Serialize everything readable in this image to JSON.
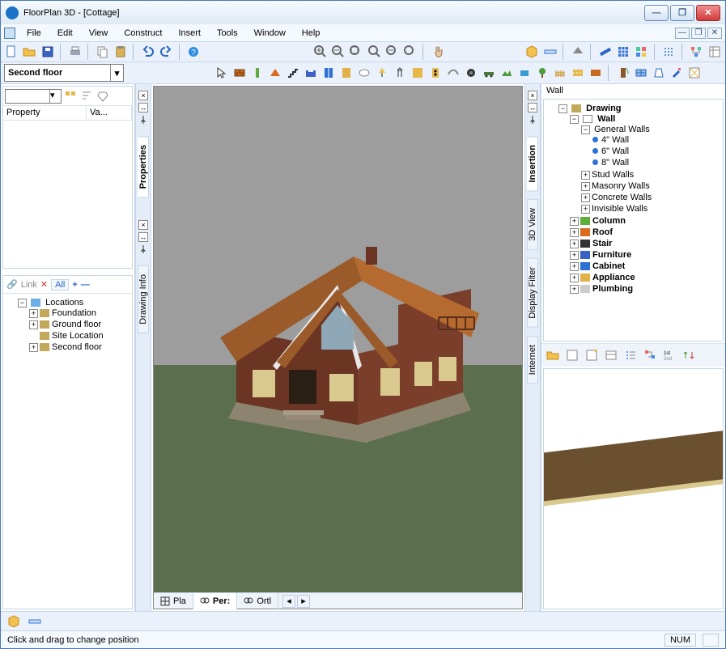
{
  "titlebar": {
    "title": "FloorPlan 3D - [Cottage]"
  },
  "menu": {
    "items": [
      "File",
      "Edit",
      "View",
      "Construct",
      "Insert",
      "Tools",
      "Window",
      "Help"
    ]
  },
  "floor_selector": {
    "value": "Second floor"
  },
  "left_panel": {
    "properties_header": {
      "col1": "Property",
      "col2": "Va..."
    },
    "locations_bar": {
      "link": "Link",
      "all": "All"
    },
    "locations_tree": {
      "root": "Locations",
      "children": [
        "Foundation",
        "Ground floor",
        "Site Location",
        "Second floor"
      ]
    }
  },
  "left_tabs": {
    "tab1": "Properties",
    "tab2": "Drawing Info"
  },
  "center": {
    "view_tabs": {
      "plan": "Pla",
      "persp": "Per:",
      "ortho": "Ortl"
    }
  },
  "center_tabs": {
    "insertion": "Insertion",
    "view3d": "3D View",
    "filter": "Display Filter",
    "internet": "Internet"
  },
  "right_panel": {
    "header": "Wall",
    "tree": {
      "drawing": "Drawing",
      "wall": "Wall",
      "general_walls": "General Walls",
      "leaves": [
        "4\" Wall",
        "6\" Wall",
        "8\" Wall"
      ],
      "other_walls": [
        "Stud Walls",
        "Masonry Walls",
        "Concrete Walls",
        "Invisible Walls"
      ],
      "siblings": [
        "Column",
        "Roof",
        "Stair",
        "Furniture",
        "Cabinet",
        "Appliance",
        "Plumbing"
      ]
    }
  },
  "status": {
    "hint": "Click and drag to change position",
    "num": "NUM"
  }
}
